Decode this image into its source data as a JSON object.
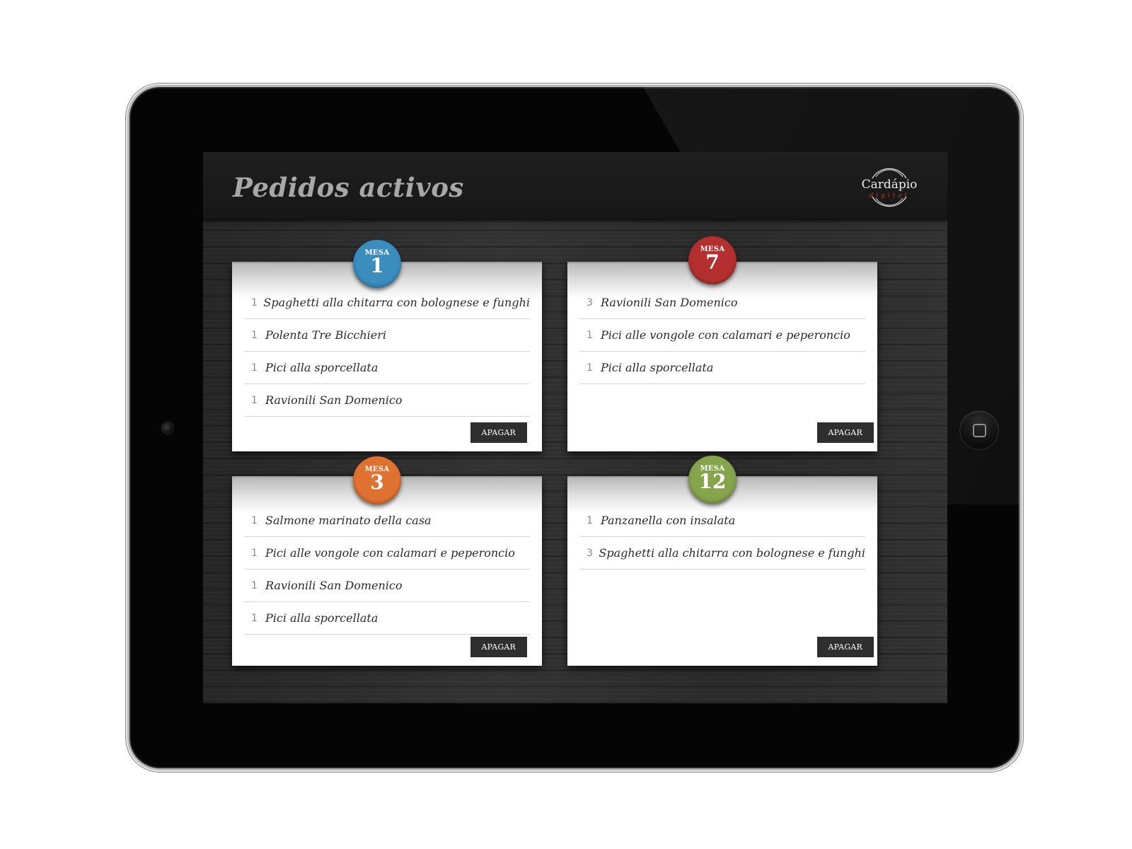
{
  "header": {
    "title": "Pedidos activos",
    "logo_text": "Cardápio",
    "logo_sub": "digital"
  },
  "orders": [
    {
      "table_label": "MESA",
      "table_number": "1",
      "color": "#3b8dbd",
      "items": [
        {
          "qty": "1",
          "name": "Spaghetti alla chitarra con bolognese e funghi"
        },
        {
          "qty": "1",
          "name": "Polenta Tre Bicchieri"
        },
        {
          "qty": "1",
          "name": "Pici alla sporcellata"
        },
        {
          "qty": "1",
          "name": "Ravionili San Domenico"
        }
      ],
      "delete_label": "APAGAR"
    },
    {
      "table_label": "MESA",
      "table_number": "7",
      "color": "#b3302e",
      "items": [
        {
          "qty": "3",
          "name": "Ravionili San Domenico"
        },
        {
          "qty": "1",
          "name": "Pici alle vongole con calamari e peperoncio"
        },
        {
          "qty": "1",
          "name": "Pici alla sporcellata"
        }
      ],
      "delete_label": "APAGAR"
    },
    {
      "table_label": "MESA",
      "table_number": "3",
      "color": "#df7230",
      "items": [
        {
          "qty": "1",
          "name": "Salmone marinato della casa"
        },
        {
          "qty": "1",
          "name": "Pici alle vongole con calamari e peperoncio"
        },
        {
          "qty": "1",
          "name": "Ravionili San Domenico"
        },
        {
          "qty": "1",
          "name": "Pici alla sporcellata"
        }
      ],
      "delete_label": "APAGAR"
    },
    {
      "table_label": "MESA",
      "table_number": "12",
      "color": "#85a44c",
      "items": [
        {
          "qty": "1",
          "name": "Panzanella con insalata"
        },
        {
          "qty": "3",
          "name": "Spaghetti alla chitarra con bolognese e funghi"
        }
      ],
      "delete_label": "APAGAR"
    }
  ]
}
